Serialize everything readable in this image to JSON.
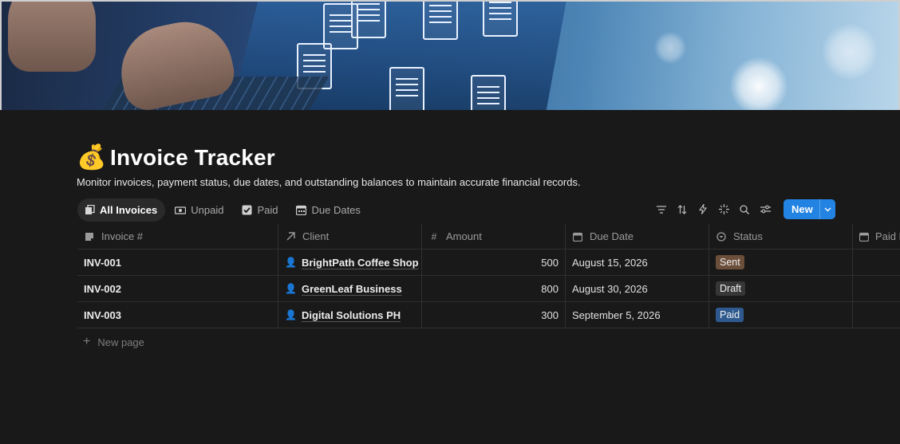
{
  "page": {
    "icon": "money-bag-icon",
    "title": "Invoice Tracker",
    "description": "Monitor invoices, payment status, due dates, and outstanding balances to maintain accurate financial records."
  },
  "tabs": [
    {
      "label": "All Invoices",
      "icon": "document-stack-icon",
      "active": true
    },
    {
      "label": "Unpaid",
      "icon": "cash-icon",
      "active": false
    },
    {
      "label": "Paid",
      "icon": "checkbox-icon",
      "active": false
    },
    {
      "label": "Due Dates",
      "icon": "calendar-icon",
      "active": false
    }
  ],
  "toolbar": {
    "new_label": "New",
    "tools": [
      "filter-icon",
      "sort-icon",
      "automation-icon",
      "ai-sparkle-icon",
      "search-icon",
      "settings-icon"
    ]
  },
  "table": {
    "columns": [
      {
        "label": "Invoice #",
        "icon": "title-icon"
      },
      {
        "label": "Client",
        "icon": "relation-arrow-icon"
      },
      {
        "label": "Amount",
        "icon": "number-icon"
      },
      {
        "label": "Due Date",
        "icon": "calendar-icon"
      },
      {
        "label": "Status",
        "icon": "status-icon"
      },
      {
        "label": "Paid D",
        "icon": "calendar-icon"
      }
    ],
    "rows": [
      {
        "invoice": "INV-001",
        "client": "BrightPath Coffee Shop",
        "amount": "500",
        "due_date": "August 15, 2026",
        "status": "Sent",
        "status_color": "#6b4f3a"
      },
      {
        "invoice": "INV-002",
        "client": "GreenLeaf Business",
        "amount": "800",
        "due_date": "August 30, 2026",
        "status": "Draft",
        "status_color": "#373737"
      },
      {
        "invoice": "INV-003",
        "client": "Digital Solutions PH",
        "amount": "300",
        "due_date": "September 5, 2026",
        "status": "Paid",
        "status_color": "#2e5a8f"
      }
    ],
    "new_page_label": "New page"
  },
  "colors": {
    "background": "#191919",
    "accent": "#2383e2"
  }
}
